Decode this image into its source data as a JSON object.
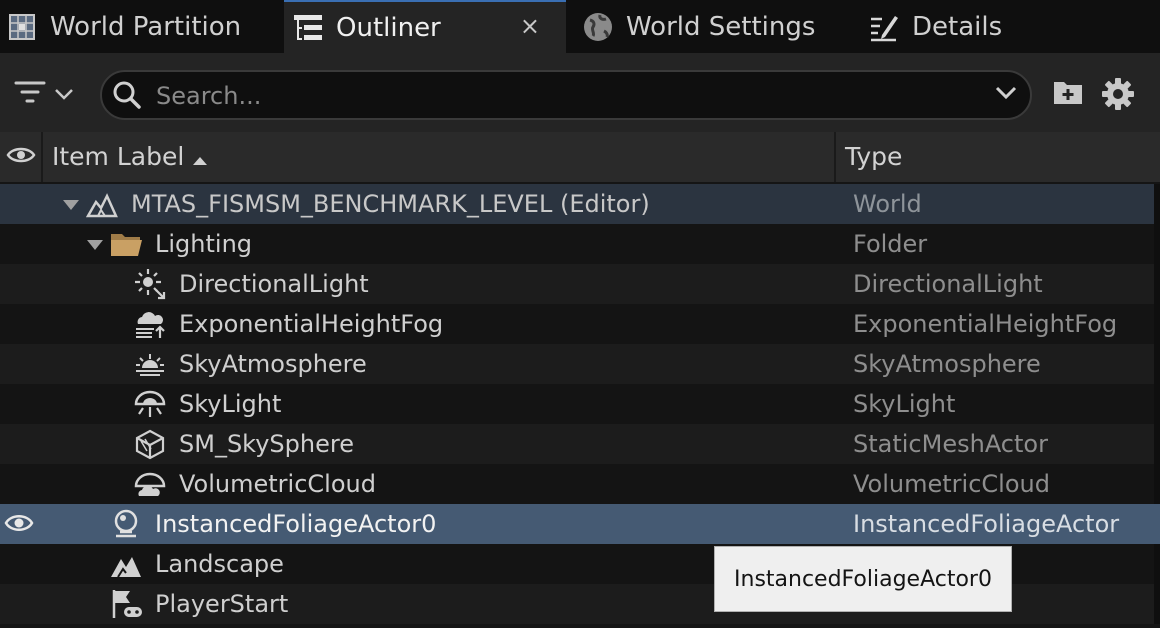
{
  "tabs": [
    {
      "label": "World Partition",
      "icon": "world-partition-icon",
      "active": false
    },
    {
      "label": "Outliner",
      "icon": "outliner-icon",
      "active": true
    },
    {
      "label": "World Settings",
      "icon": "globe-icon",
      "active": false
    },
    {
      "label": "Details",
      "icon": "details-icon",
      "active": false
    }
  ],
  "tab_close_glyph": "×",
  "search": {
    "placeholder": "Search...",
    "value": ""
  },
  "header": {
    "item_label": "Item Label",
    "type": "Type"
  },
  "rows": [
    {
      "label": "MTAS_FISMSM_BENCHMARK_LEVEL (Editor)",
      "type": "World",
      "icon": "world-icon"
    },
    {
      "label": "Lighting",
      "type": "Folder",
      "icon": "folder-icon"
    },
    {
      "label": "DirectionalLight",
      "type": "DirectionalLight",
      "icon": "directional-light-icon"
    },
    {
      "label": "ExponentialHeightFog",
      "type": "ExponentialHeightFog",
      "icon": "height-fog-icon"
    },
    {
      "label": "SkyAtmosphere",
      "type": "SkyAtmosphere",
      "icon": "sky-atmosphere-icon"
    },
    {
      "label": "SkyLight",
      "type": "SkyLight",
      "icon": "sky-light-icon"
    },
    {
      "label": "SM_SkySphere",
      "type": "StaticMeshActor",
      "icon": "static-mesh-icon"
    },
    {
      "label": "VolumetricCloud",
      "type": "VolumetricCloud",
      "icon": "volumetric-cloud-icon"
    },
    {
      "label": "InstancedFoliageActor0",
      "type": "InstancedFoliageActor",
      "icon": "foliage-actor-icon",
      "selected": true
    },
    {
      "label": "Landscape",
      "type": "",
      "icon": "landscape-icon"
    },
    {
      "label": "PlayerStart",
      "type": "",
      "icon": "player-start-icon"
    }
  ],
  "tooltip": {
    "text": "InstancedFoliageActor0"
  },
  "colors": {
    "selected_row": "#455a73",
    "world_row": "#2b3440",
    "folder": "#c9a064",
    "active_tab_accent": "#3a6fb3"
  }
}
